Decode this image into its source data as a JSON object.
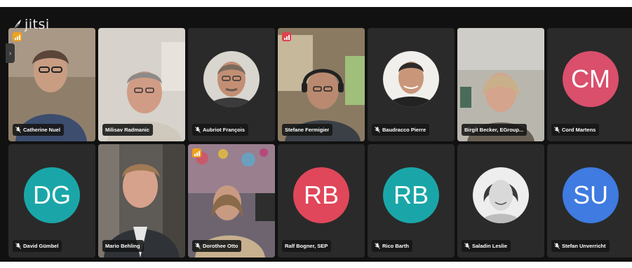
{
  "app": {
    "brand": "jitsi"
  },
  "colors": {
    "stage": "#111111",
    "tile": "#2a2a2a",
    "active_border": "#3d8bfd",
    "quality_warn": "#f0a21f",
    "quality_bad": "#e0424f",
    "avatar_cm": "#d94f6c",
    "avatar_dg": "#1aa6a8",
    "avatar_rb_ralf": "#e0475a",
    "avatar_rb_rico": "#1aa6a8",
    "avatar_su": "#3f7be0"
  },
  "participants": [
    {
      "name": "Catherine Nuel",
      "muted": true,
      "quality": "warn"
    },
    {
      "name": "Milisav Radmanic",
      "muted": false
    },
    {
      "name": "Aubriot François",
      "muted": true
    },
    {
      "name": "Stefane Fermigier",
      "muted": false,
      "quality": "bad",
      "active": true
    },
    {
      "name": "Baudracco Pierre",
      "muted": true
    },
    {
      "name": "Birgit Becker, EGroup...",
      "muted": false
    },
    {
      "name": "Cord Martens",
      "muted": true,
      "initials": "CM"
    },
    {
      "name": "David Gümbel",
      "muted": true,
      "initials": "DG"
    },
    {
      "name": "Mario Behling",
      "muted": false
    },
    {
      "name": "Dorothee Otto",
      "muted": true,
      "quality": "warn"
    },
    {
      "name": "Ralf Bogner, SEP",
      "muted": false,
      "initials": "RB"
    },
    {
      "name": "Rico Barth",
      "muted": true,
      "initials": "RB"
    },
    {
      "name": "Saladin Leslie",
      "muted": true
    },
    {
      "name": "Stefan Unverricht",
      "muted": true,
      "initials": "SU"
    }
  ]
}
